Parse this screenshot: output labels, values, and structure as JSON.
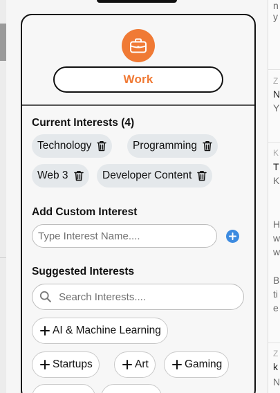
{
  "category": {
    "label": "Work",
    "icon": "briefcase-icon",
    "accent_color": "#f07a35"
  },
  "current_interests": {
    "title": "Current Interests (4)",
    "items": [
      {
        "label": "Technology"
      },
      {
        "label": "Programming"
      },
      {
        "label": "Web 3"
      },
      {
        "label": "Developer Content"
      }
    ]
  },
  "custom_interest": {
    "title": "Add Custom Interest",
    "placeholder": "Type Interest Name....",
    "add_icon": "plus-circle-icon",
    "add_color": "#3d8be0"
  },
  "suggested_interests": {
    "title": "Suggested Interests",
    "search_placeholder": "Search Interests....",
    "items": [
      {
        "label": "AI & Machine Learning"
      },
      {
        "label": "Startups"
      },
      {
        "label": "Art"
      },
      {
        "label": "Gaming"
      }
    ]
  },
  "background": {
    "right_fragments": [
      "n",
      "y",
      "Z",
      "N",
      "Y",
      "K",
      "T",
      "K",
      "H",
      "w",
      "w",
      "B",
      "ti",
      "e",
      "Z",
      "k",
      "N"
    ]
  }
}
